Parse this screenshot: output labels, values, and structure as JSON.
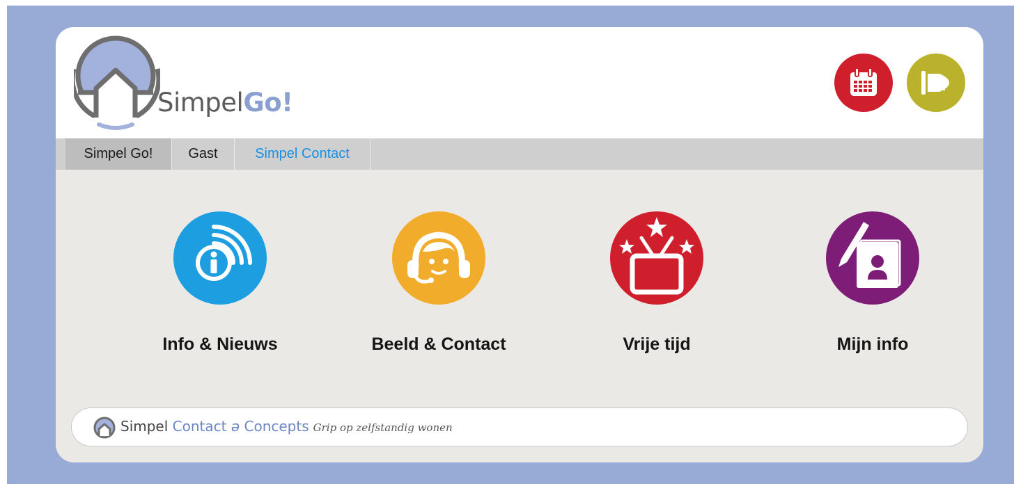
{
  "brand": {
    "name_part1": "Simpel",
    "name_part2": "Go!"
  },
  "header_buttons": [
    {
      "icon": "calendar-icon",
      "color": "#cf1f2d"
    },
    {
      "icon": "megaphone-icon",
      "color": "#bab12d"
    }
  ],
  "tabs": [
    {
      "label": "Simpel Go!",
      "active": true
    },
    {
      "label": "Gast",
      "active": false
    },
    {
      "label": "Simpel Contact",
      "active": false
    }
  ],
  "tiles": [
    {
      "label": "Info & Nieuws",
      "icon": "info-broadcast-icon",
      "color": "#1c9ee0"
    },
    {
      "label": "Beeld & Contact",
      "icon": "headset-agent-icon",
      "color": "#f2ac2b"
    },
    {
      "label": "Vrije tijd",
      "icon": "tv-stars-icon",
      "color": "#cf1f2d"
    },
    {
      "label": "Mijn info",
      "icon": "contact-book-icon",
      "color": "#7d1d78"
    }
  ],
  "footer": {
    "brand_part1": "Simpel",
    "brand_part2": "Contact",
    "brand_part3": "Concepts",
    "tagline": "Grip op zelfstandig wonen"
  },
  "colors": {
    "background": "#98abd6",
    "card": "#ebe9e5",
    "tabbar": "#cfcfcf",
    "link": "#1a8fe3"
  }
}
